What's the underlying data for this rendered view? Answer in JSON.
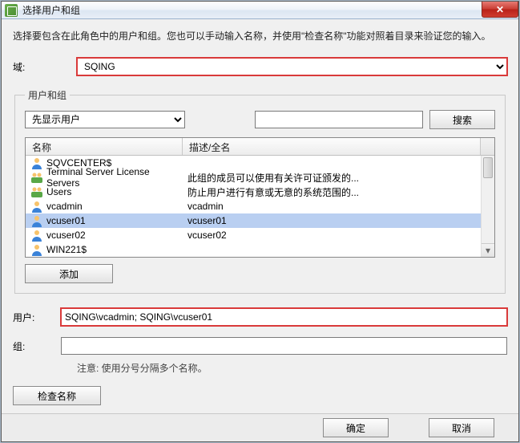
{
  "title": "选择用户和组",
  "instruction": "选择要包含在此角色中的用户和组。您也可以手动输入名称，并使用\"检查名称\"功能对照着目录来验证您的输入。",
  "domain": {
    "label": "域:",
    "value": "SQING"
  },
  "group": {
    "legend": "用户和组",
    "filter_value": "先显示用户",
    "search_value": "",
    "search_btn": "搜索",
    "col_name": "名称",
    "col_desc": "描述/全名",
    "rows": [
      {
        "type": "user",
        "name": "SQVCENTER$",
        "desc": ""
      },
      {
        "type": "group",
        "name": "Terminal Server License Servers",
        "desc": "此组的成员可以使用有关许可证颁发的..."
      },
      {
        "type": "group",
        "name": "Users",
        "desc": "防止用户进行有意或无意的系统范围的..."
      },
      {
        "type": "user",
        "name": "vcadmin",
        "desc": "vcadmin"
      },
      {
        "type": "user",
        "name": "vcuser01",
        "desc": "vcuser01",
        "selected": true
      },
      {
        "type": "user",
        "name": "vcuser02",
        "desc": "vcuser02"
      },
      {
        "type": "user",
        "name": "WIN221$",
        "desc": ""
      }
    ],
    "add_btn": "添加"
  },
  "users_field": {
    "label": "用户:",
    "value": "SQING\\vcadmin; SQING\\vcuser01"
  },
  "groups_field": {
    "label": "组:",
    "value": ""
  },
  "hint": "注意: 使用分号分隔多个名称。",
  "check_btn": "检查名称",
  "ok_btn": "确定",
  "cancel_btn": "取消"
}
